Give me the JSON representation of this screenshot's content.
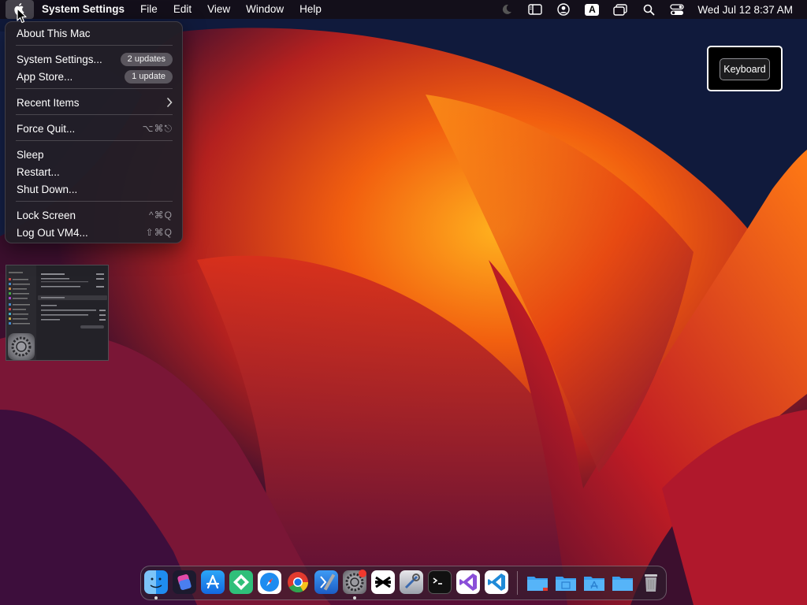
{
  "menubar": {
    "app_name": "System Settings",
    "menus": [
      "File",
      "Edit",
      "View",
      "Window",
      "Help"
    ],
    "status_icons": [
      "moon-icon",
      "sidebar-icon",
      "user-icon",
      "input-source-icon",
      "display-icon",
      "search-icon",
      "control-center-icon"
    ],
    "input_source_glyph": "A",
    "clock": "Wed Jul 12  8:37 AM"
  },
  "apple_menu": {
    "about": "About This Mac",
    "system_settings": "System Settings...",
    "system_settings_badge": "2 updates",
    "app_store": "App Store...",
    "app_store_badge": "1 update",
    "recent_items": "Recent Items",
    "force_quit": "Force Quit...",
    "force_quit_shortcut": "⌥⌘⎋",
    "sleep": "Sleep",
    "restart": "Restart...",
    "shut_down": "Shut Down...",
    "lock_screen": "Lock Screen",
    "lock_screen_shortcut": "^⌘Q",
    "log_out": "Log Out VM4...",
    "log_out_shortcut": "⇧⌘Q"
  },
  "keyboard_overlay": {
    "label": "Keyboard"
  },
  "dock": {
    "apps": [
      "finder-icon",
      "shortcuts-icon",
      "app-store-icon",
      "xcode-cloud-icon",
      "safari-icon",
      "chrome-icon",
      "xcode-icon",
      "system-settings-icon",
      "capcut-icon",
      "instruments-icon",
      "terminal-icon",
      "visual-studio-icon",
      "vscode-icon"
    ],
    "folders": [
      "downloads-folder-icon",
      "documents-folder-icon",
      "applications-folder-icon",
      "desktop-folder-icon",
      "trash-icon"
    ],
    "colors": {
      "accent": "#1f8cf0"
    }
  }
}
